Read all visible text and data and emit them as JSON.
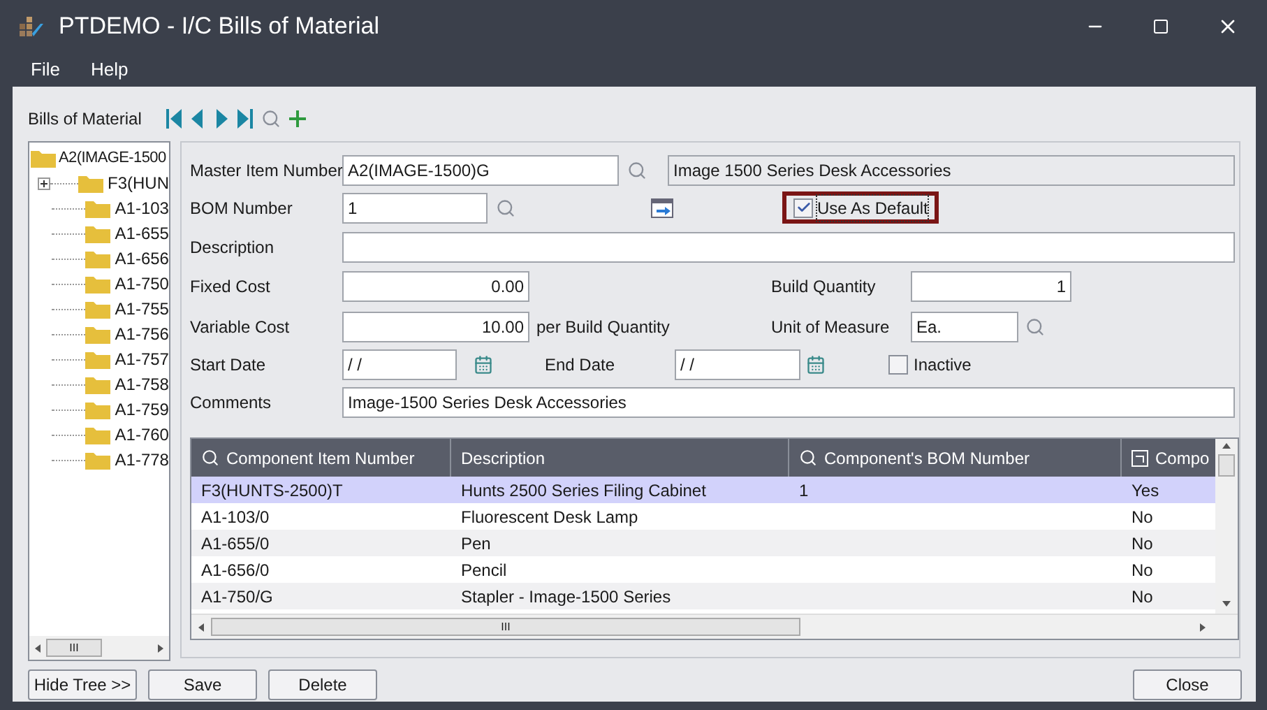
{
  "window": {
    "title": "PTDEMO - I/C Bills of Material"
  },
  "menu": [
    {
      "label": "File"
    },
    {
      "label": "Help"
    }
  ],
  "toolbar": {
    "label": "Bills of Material"
  },
  "tree": {
    "label": "A2(IMAGE-1500",
    "children": [
      {
        "label": "F3(HUN",
        "expandable": true
      },
      {
        "label": "A1-103",
        "expandable": false
      },
      {
        "label": "A1-655",
        "expandable": false
      },
      {
        "label": "A1-656",
        "expandable": false
      },
      {
        "label": "A1-750",
        "expandable": false
      },
      {
        "label": "A1-755",
        "expandable": false
      },
      {
        "label": "A1-756",
        "expandable": false
      },
      {
        "label": "A1-757",
        "expandable": false
      },
      {
        "label": "A1-758",
        "expandable": false
      },
      {
        "label": "A1-759",
        "expandable": false
      },
      {
        "label": "A1-760",
        "expandable": false
      },
      {
        "label": "A1-778",
        "expandable": false
      }
    ]
  },
  "form": {
    "master_item_number": {
      "label": "Master Item Number",
      "value": "A2(IMAGE-1500)G",
      "description": "Image 1500 Series Desk Accessories"
    },
    "bom_number": {
      "label": "BOM Number",
      "value": "1"
    },
    "use_as_default": {
      "label": "Use As Default",
      "checked": true,
      "focused": true
    },
    "description": {
      "label": "Description"
    },
    "fixed_cost": {
      "label": "Fixed Cost",
      "value": "0.00"
    },
    "build_quantity": {
      "label": "Build Quantity",
      "value": "1"
    },
    "variable_cost": {
      "label": "Variable Cost",
      "value": "10.00",
      "suffix": "per Build Quantity"
    },
    "unit_of_measure": {
      "label": "Unit of Measure",
      "value": "Ea."
    },
    "start_date": {
      "label": "Start Date",
      "value": "/ /"
    },
    "end_date": {
      "label": "End Date",
      "value": "/ /"
    },
    "inactive": {
      "label": "Inactive",
      "checked": false
    },
    "comments": {
      "label": "Comments",
      "value": "Image-1500 Series Desk Accessories"
    }
  },
  "table": {
    "columns": [
      {
        "label": "Component Item Number",
        "kind": "lookup"
      },
      {
        "label": "Description",
        "kind": "plain"
      },
      {
        "label": "Component's BOM Number",
        "kind": "lookup"
      },
      {
        "label": "Compo",
        "kind": "flag"
      }
    ],
    "rows": [
      {
        "cells": [
          "F3(HUNTS-2500)T",
          "Hunts 2500 Series Filing Cabinet",
          "1",
          "Yes"
        ],
        "selected": true
      },
      {
        "cells": [
          "A1-103/0",
          "Fluorescent Desk Lamp",
          "",
          "No"
        ],
        "selected": false
      },
      {
        "cells": [
          "A1-655/0",
          "Pen",
          "",
          "No"
        ],
        "selected": false
      },
      {
        "cells": [
          "A1-656/0",
          "Pencil",
          "",
          "No"
        ],
        "selected": false
      },
      {
        "cells": [
          "A1-750/G",
          "Stapler - Image-1500 Series",
          "",
          "No"
        ],
        "selected": false
      }
    ]
  },
  "buttons": [
    {
      "label": "Hide Tree >>"
    },
    {
      "label": "Save"
    },
    {
      "label": "Delete"
    }
  ],
  "close_button": {
    "label": "Close"
  },
  "tree_scroll_glyph": "III",
  "grid_scroll_glyph": "III"
}
